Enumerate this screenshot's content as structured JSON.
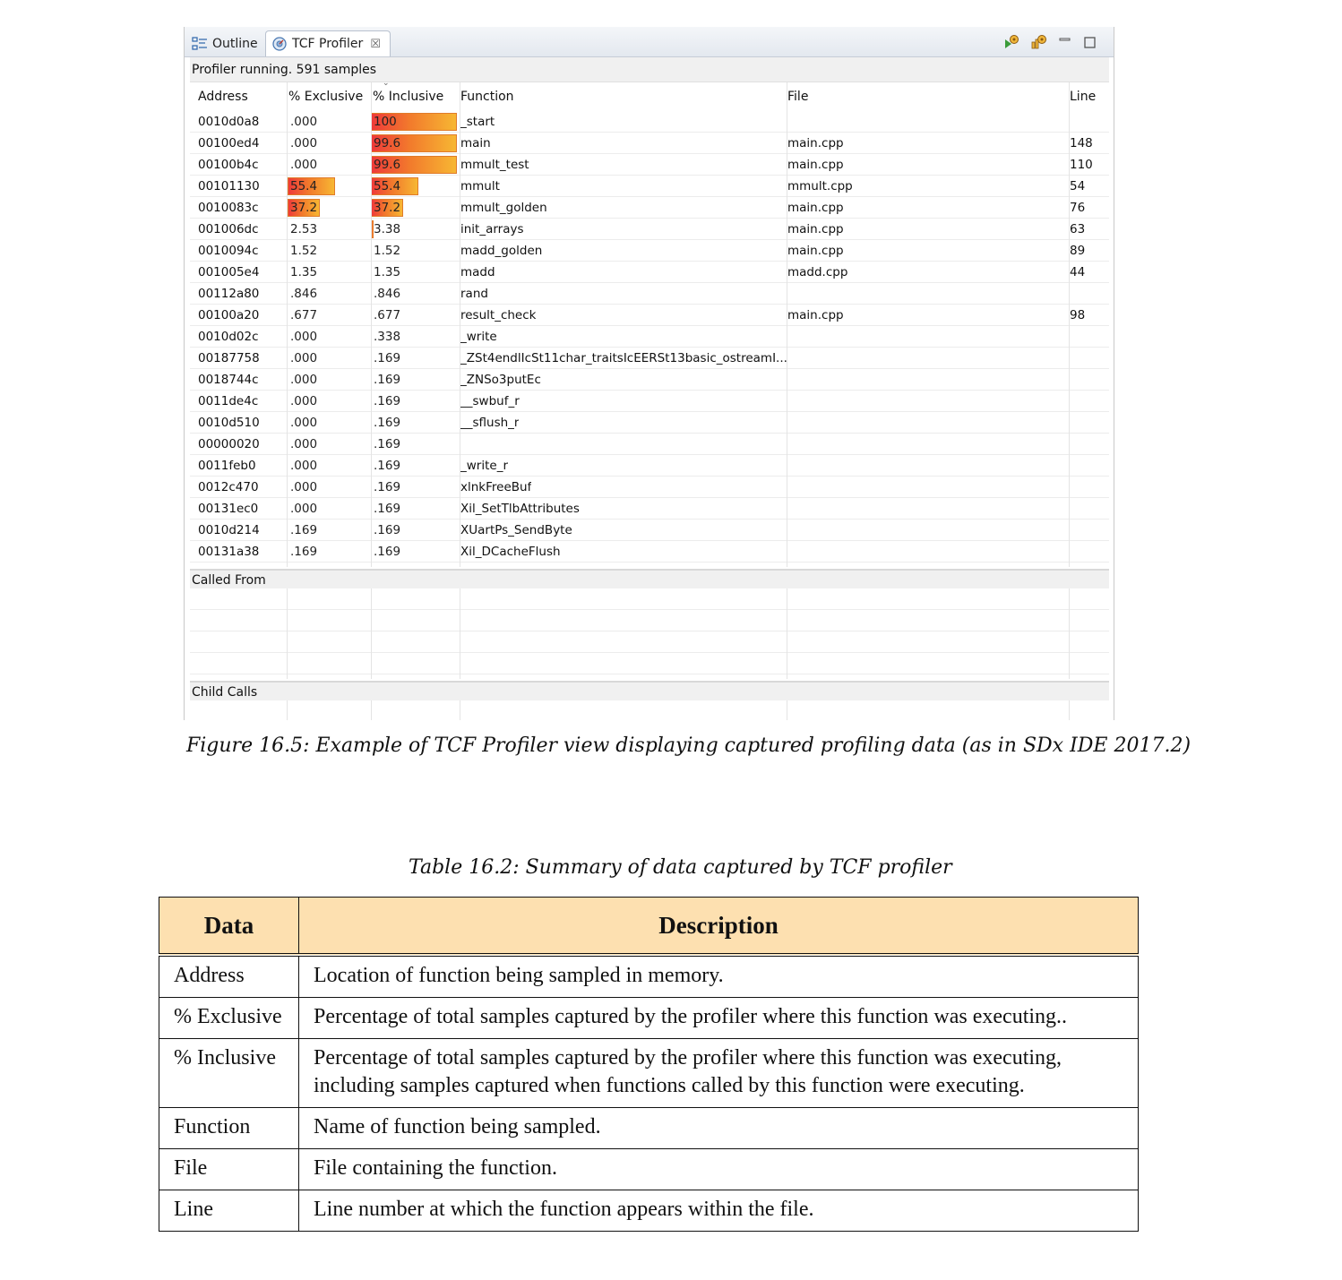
{
  "view": {
    "tabs": [
      {
        "label": "Outline",
        "icon": "outline-icon"
      },
      {
        "label": "TCF Profiler",
        "icon": "profiler-icon",
        "close": "☒"
      }
    ],
    "status": "Profiler running. 591 samples",
    "columns": [
      "Address",
      "% Exclusive",
      "% Inclusive",
      "Function",
      "File",
      "Line"
    ],
    "rows": [
      {
        "address": "0010d0a8",
        "exclusive": ".000",
        "inclusive": "100",
        "excl_pct": 0,
        "incl_pct": 100,
        "function": "_start",
        "file": "",
        "line": ""
      },
      {
        "address": "00100ed4",
        "exclusive": ".000",
        "inclusive": "99.6",
        "excl_pct": 0,
        "incl_pct": 99.6,
        "function": "main",
        "file": "main.cpp",
        "line": "148"
      },
      {
        "address": "00100b4c",
        "exclusive": ".000",
        "inclusive": "99.6",
        "excl_pct": 0,
        "incl_pct": 99.6,
        "function": "mmult_test",
        "file": "main.cpp",
        "line": "110"
      },
      {
        "address": "00101130",
        "exclusive": "55.4",
        "inclusive": "55.4",
        "excl_pct": 55.4,
        "incl_pct": 55.4,
        "function": "mmult",
        "file": "mmult.cpp",
        "line": "54"
      },
      {
        "address": "0010083c",
        "exclusive": "37.2",
        "inclusive": "37.2",
        "excl_pct": 37.2,
        "incl_pct": 37.2,
        "function": "mmult_golden",
        "file": "main.cpp",
        "line": "76"
      },
      {
        "address": "001006dc",
        "exclusive": "2.53",
        "inclusive": "3.38",
        "excl_pct": 0,
        "incl_pct": 3.38,
        "function": "init_arrays",
        "file": "main.cpp",
        "line": "63"
      },
      {
        "address": "0010094c",
        "exclusive": "1.52",
        "inclusive": "1.52",
        "excl_pct": 0,
        "incl_pct": 0,
        "function": "madd_golden",
        "file": "main.cpp",
        "line": "89"
      },
      {
        "address": "001005e4",
        "exclusive": "1.35",
        "inclusive": "1.35",
        "excl_pct": 0,
        "incl_pct": 0,
        "function": "madd",
        "file": "madd.cpp",
        "line": "44"
      },
      {
        "address": "00112a80",
        "exclusive": ".846",
        "inclusive": ".846",
        "excl_pct": 0,
        "incl_pct": 0,
        "function": "rand",
        "file": "",
        "line": ""
      },
      {
        "address": "00100a20",
        "exclusive": ".677",
        "inclusive": ".677",
        "excl_pct": 0,
        "incl_pct": 0,
        "function": "result_check",
        "file": "main.cpp",
        "line": "98"
      },
      {
        "address": "0010d02c",
        "exclusive": ".000",
        "inclusive": ".338",
        "excl_pct": 0,
        "incl_pct": 0,
        "function": "_write",
        "file": "",
        "line": ""
      },
      {
        "address": "00187758",
        "exclusive": ".000",
        "inclusive": ".169",
        "excl_pct": 0,
        "incl_pct": 0,
        "function": "_ZSt4endlIcSt11char_traitsIcEERSt13basic_ostreamI...",
        "file": "",
        "line": ""
      },
      {
        "address": "0018744c",
        "exclusive": ".000",
        "inclusive": ".169",
        "excl_pct": 0,
        "incl_pct": 0,
        "function": "_ZNSo3putEc",
        "file": "",
        "line": ""
      },
      {
        "address": "0011de4c",
        "exclusive": ".000",
        "inclusive": ".169",
        "excl_pct": 0,
        "incl_pct": 0,
        "function": "__swbuf_r",
        "file": "",
        "line": ""
      },
      {
        "address": "0010d510",
        "exclusive": ".000",
        "inclusive": ".169",
        "excl_pct": 0,
        "incl_pct": 0,
        "function": "__sflush_r",
        "file": "",
        "line": ""
      },
      {
        "address": "00000020",
        "exclusive": ".000",
        "inclusive": ".169",
        "excl_pct": 0,
        "incl_pct": 0,
        "function": "",
        "file": "",
        "line": ""
      },
      {
        "address": "0011feb0",
        "exclusive": ".000",
        "inclusive": ".169",
        "excl_pct": 0,
        "incl_pct": 0,
        "function": "_write_r",
        "file": "",
        "line": ""
      },
      {
        "address": "0012c470",
        "exclusive": ".000",
        "inclusive": ".169",
        "excl_pct": 0,
        "incl_pct": 0,
        "function": "xlnkFreeBuf",
        "file": "",
        "line": ""
      },
      {
        "address": "00131ec0",
        "exclusive": ".000",
        "inclusive": ".169",
        "excl_pct": 0,
        "incl_pct": 0,
        "function": "Xil_SetTlbAttributes",
        "file": "",
        "line": ""
      },
      {
        "address": "0010d214",
        "exclusive": ".169",
        "inclusive": ".169",
        "excl_pct": 0,
        "incl_pct": 0,
        "function": "XUartPs_SendByte",
        "file": "",
        "line": ""
      },
      {
        "address": "00131a38",
        "exclusive": ".169",
        "inclusive": ".169",
        "excl_pct": 0,
        "incl_pct": 0,
        "function": "Xil_DCacheFlush",
        "file": "",
        "line": ""
      }
    ],
    "called_from": "Called From",
    "child_calls": "Child Calls"
  },
  "figure_caption": "Figure 16.5: Example of TCF Profiler view displaying captured profiling data (as in SDx IDE 2017.2)",
  "table_caption": "Table 16.2: Summary of data captured by TCF profiler",
  "summary": {
    "headers": [
      "Data",
      "Description"
    ],
    "rows": [
      {
        "data": "Address",
        "description": "Location of function being sampled in memory."
      },
      {
        "data": "% Exclusive",
        "description": "Percentage of total samples captured by the profiler where this function was executing.."
      },
      {
        "data": "% Inclusive",
        "description": "Percentage of total samples captured by the profiler where this function was executing, including samples captured when functions called by this function were executing."
      },
      {
        "data": "Function",
        "description": "Name of function being sampled."
      },
      {
        "data": "File",
        "description": "File containing the function."
      },
      {
        "data": "Line",
        "description": "Line number at which the function appears within the file."
      }
    ]
  },
  "colors": {
    "table_header_bg": "#fde0b0",
    "bar_start": "#ee3a3a",
    "bar_end": "#f7b733"
  }
}
